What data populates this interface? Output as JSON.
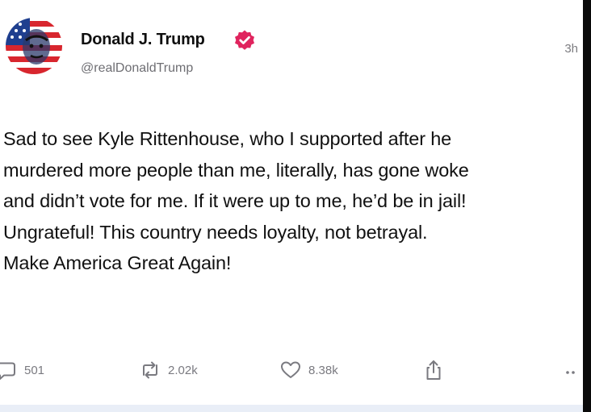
{
  "post": {
    "author_name": "Donald J. Trump",
    "handle": "@realDonaldTrump",
    "time": "3h",
    "text": "Sad to see Kyle Rittenhouse, who I supported after he\nmurdered more people than me, literally, has gone woke\nand didn’t vote for me. If it were up to me, he’d be in jail!\nUngrateful! This country needs loyalty, not betrayal.\nMake America Great Again!"
  },
  "actions": {
    "replies": "501",
    "reposts": "2.02k",
    "likes": "8.38k"
  },
  "icons": {
    "verified": "verified-badge-icon",
    "reply": "reply-bubble-icon",
    "repost": "repost-arrows-icon",
    "like": "heart-icon",
    "share": "share-upload-icon",
    "more": "more-dots-icon"
  },
  "colors": {
    "verified_badge": "#e0245e",
    "text": "#111111",
    "muted": "#7a7a80"
  }
}
